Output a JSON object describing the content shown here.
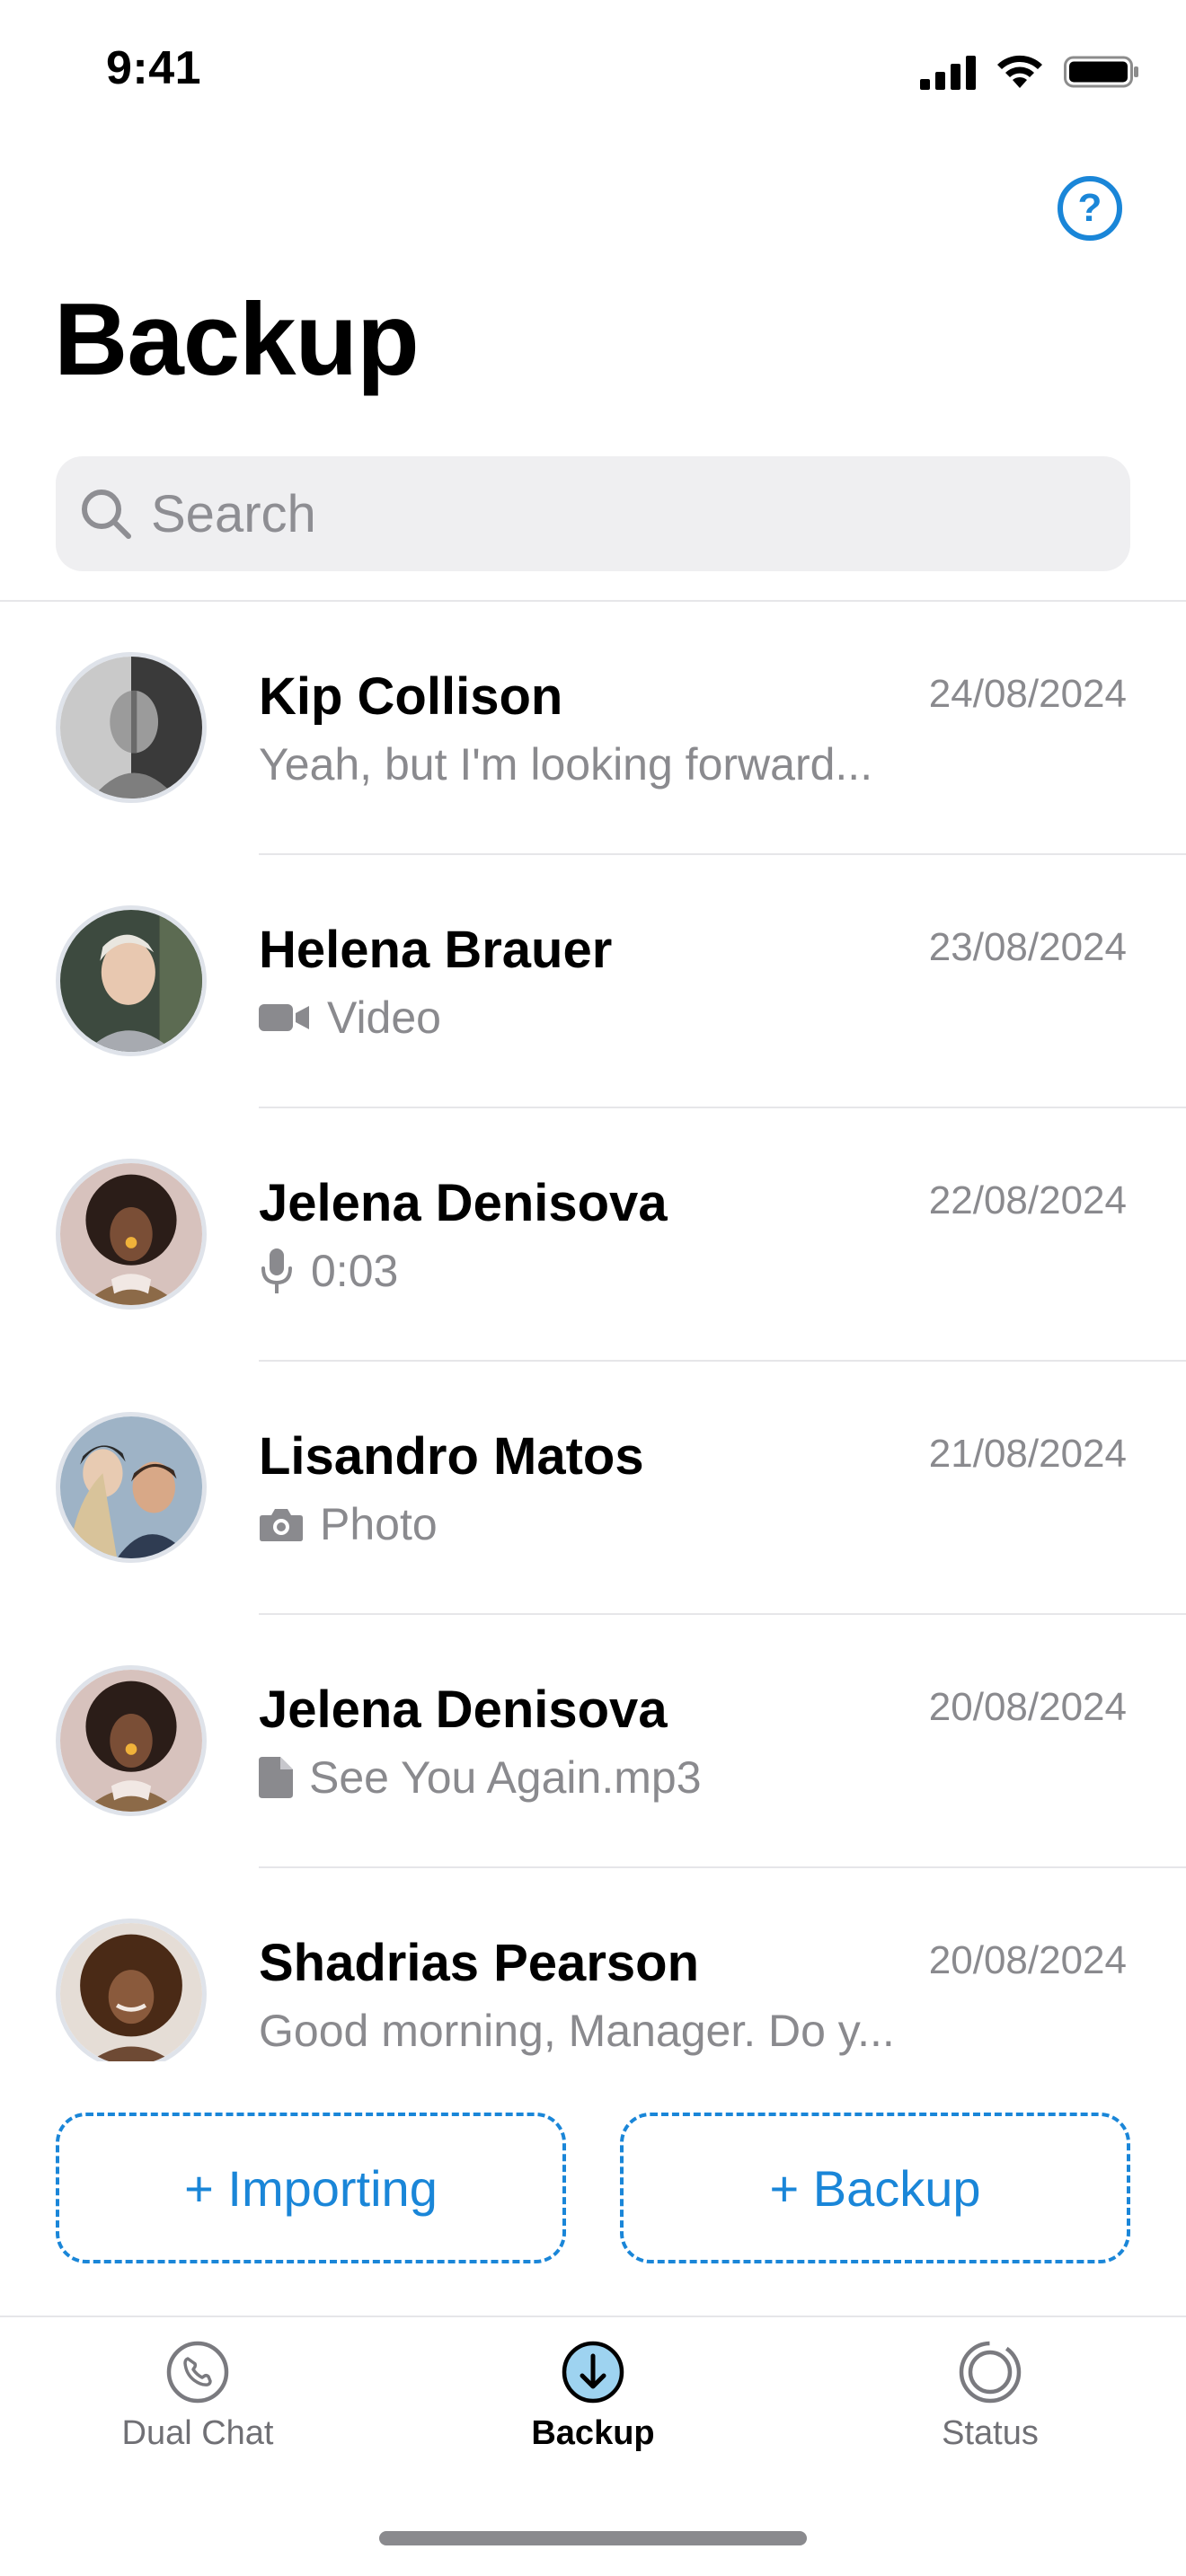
{
  "status_bar": {
    "time": "9:41"
  },
  "header": {
    "title": "Backup",
    "help_label": "?"
  },
  "search": {
    "placeholder": "Search"
  },
  "chats": [
    {
      "name": "Kip Collison",
      "date": "24/08/2024",
      "preview": "Yeah, but I'm looking forward...",
      "preview_icon": ""
    },
    {
      "name": "Helena Brauer",
      "date": "23/08/2024",
      "preview": "Video",
      "preview_icon": "video-icon"
    },
    {
      "name": "Jelena Denisova",
      "date": "22/08/2024",
      "preview": "0:03",
      "preview_icon": "microphone-icon"
    },
    {
      "name": "Lisandro Matos",
      "date": "21/08/2024",
      "preview": "Photo",
      "preview_icon": "camera-icon"
    },
    {
      "name": "Jelena Denisova",
      "date": "20/08/2024",
      "preview": "See You Again.mp3",
      "preview_icon": "document-icon"
    },
    {
      "name": "Shadrias Pearson",
      "date": "20/08/2024",
      "preview": "Good morning, Manager. Do y...",
      "preview_icon": ""
    }
  ],
  "actions": {
    "importing_label": "+ Importing",
    "backup_label": "+ Backup"
  },
  "tabs": [
    {
      "label": "Dual Chat",
      "icon": "phone-icon"
    },
    {
      "label": "Backup",
      "icon": "download-circle-icon",
      "active": true
    },
    {
      "label": "Status",
      "icon": "status-ring-icon"
    }
  ],
  "colors": {
    "accent": "#1a86d8",
    "secondary_text": "#8a8a8e",
    "search_bg": "#efeff1"
  }
}
